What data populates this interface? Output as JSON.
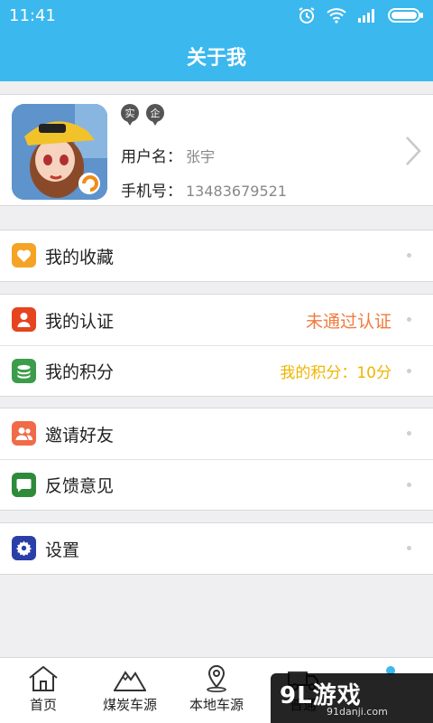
{
  "status_bar": {
    "time": "11:41"
  },
  "header": {
    "title": "关于我"
  },
  "profile": {
    "badges": [
      "实",
      "企"
    ],
    "username_label": "用户名：",
    "username": "张宇",
    "phone_label": "手机号：",
    "phone": "13483679521"
  },
  "menu": {
    "favorites": {
      "label": "我的收藏"
    },
    "certification": {
      "label": "我的认证",
      "status": "未通过认证"
    },
    "points": {
      "label": "我的积分",
      "value": "我的积分：10分"
    },
    "invite": {
      "label": "邀请好友"
    },
    "feedback": {
      "label": "反馈意见"
    },
    "settings": {
      "label": "设置"
    }
  },
  "bottom_nav": {
    "items": [
      {
        "label": "首页",
        "icon": "home-icon"
      },
      {
        "label": "煤炭车源",
        "icon": "mountain-icon"
      },
      {
        "label": "本地车源",
        "icon": "location-pin-icon"
      },
      {
        "label": "普通",
        "icon": "truck-icon"
      }
    ]
  },
  "watermark": {
    "main": "9L游戏",
    "sub": "91danji.com"
  },
  "colors": {
    "header": "#3bb8ee",
    "favorites_icon": "#f5a325",
    "certification_icon": "#e6431f",
    "points_icon": "#3d9c4b",
    "invite_icon": "#f06b48",
    "feedback_icon": "#2e8b3a",
    "settings_icon": "#2b3fa8",
    "status_orange": "#f07a3e",
    "points_yellow": "#f0b400"
  }
}
